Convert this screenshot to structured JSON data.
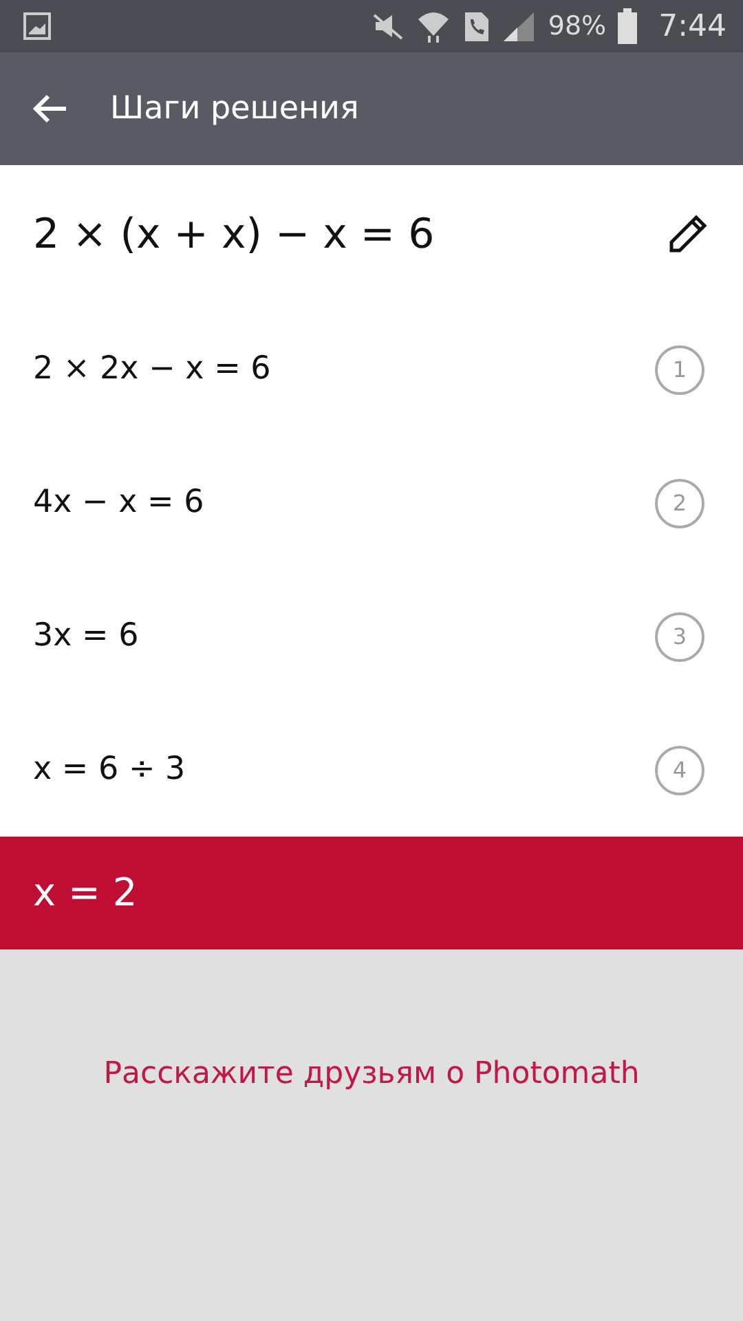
{
  "status_bar": {
    "battery": "98%",
    "time": "7:44"
  },
  "app_bar": {
    "title": "Шаги решения"
  },
  "problem": {
    "expression": "2 × (x + x) − x = 6"
  },
  "steps": [
    {
      "expression": "2 × 2x − x = 6",
      "number": "1"
    },
    {
      "expression": "4x − x = 6",
      "number": "2"
    },
    {
      "expression": "3x = 6",
      "number": "3"
    },
    {
      "expression": "x = 6 ÷ 3",
      "number": "4"
    }
  ],
  "result": {
    "expression": "x = 2"
  },
  "share_link": "Расскажите друзьям о Photomath"
}
